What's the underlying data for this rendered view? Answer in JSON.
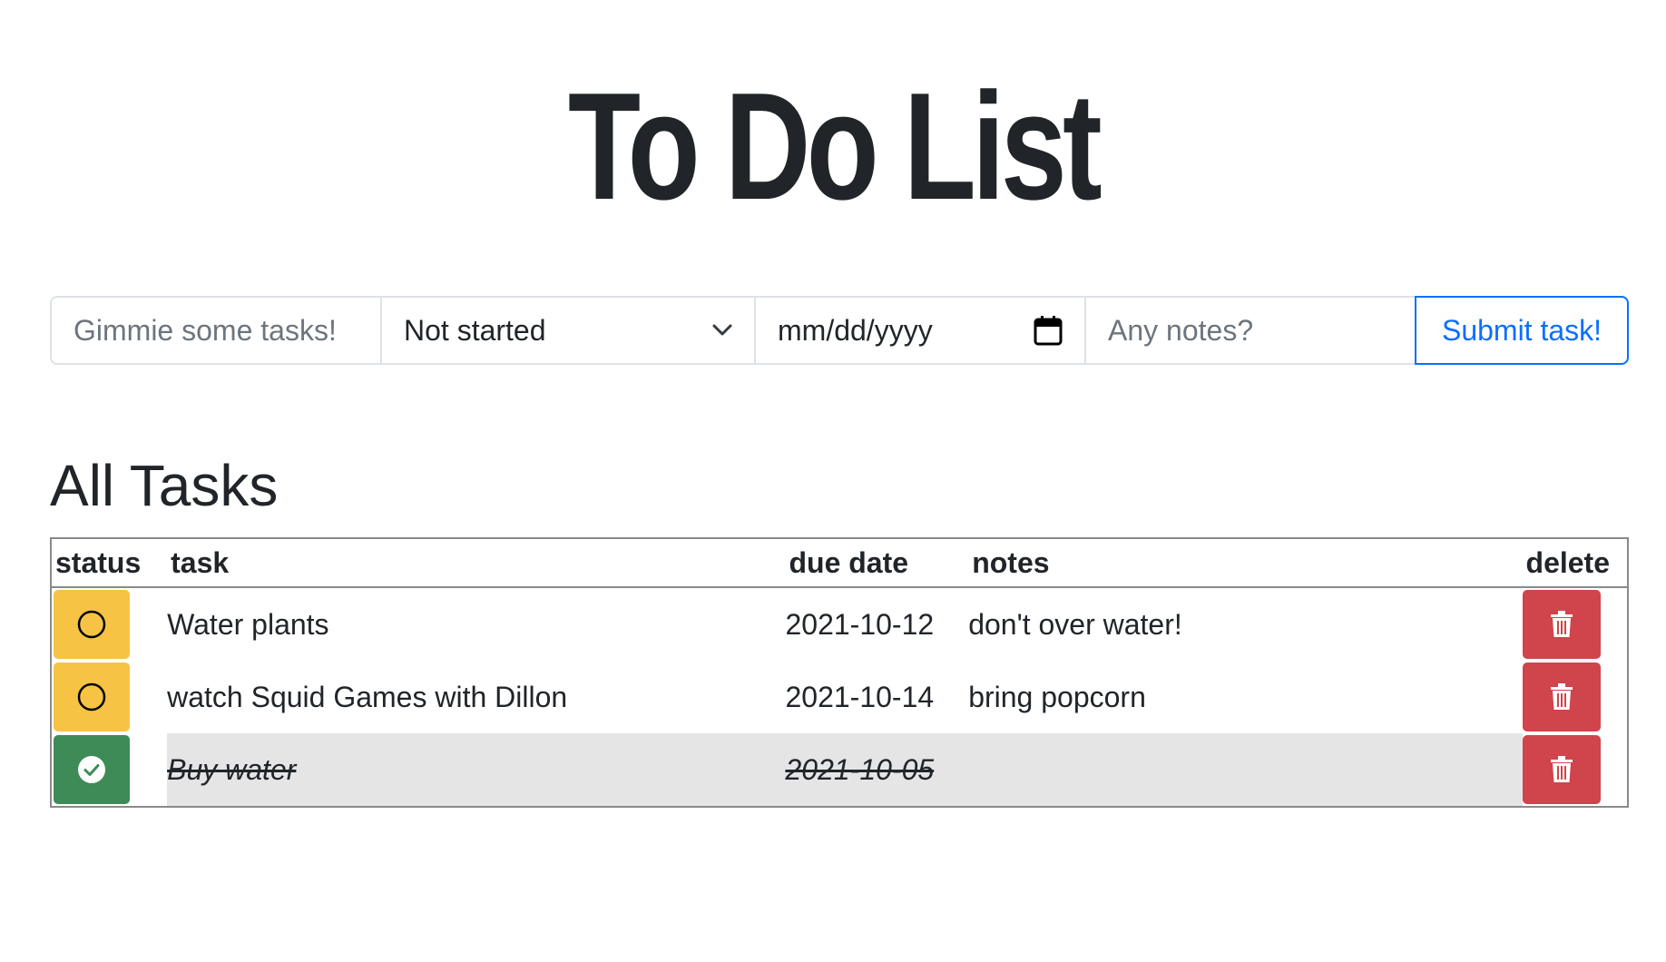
{
  "page": {
    "title": "To Do List"
  },
  "form": {
    "task_placeholder": "Gimmie some tasks!",
    "status_selected": "Not started",
    "date_placeholder": "mm/dd/yyyy",
    "notes_placeholder": "Any notes?",
    "submit_label": "Submit task!"
  },
  "section": {
    "title": "All Tasks"
  },
  "table": {
    "headers": {
      "status": "status",
      "task": "task",
      "due": "due date",
      "notes": "notes",
      "delete": "delete"
    },
    "rows": [
      {
        "task": "Water plants",
        "due": "2021-10-12",
        "notes": "don't over water!",
        "done": false
      },
      {
        "task": "watch Squid Games with Dillon",
        "due": "2021-10-14",
        "notes": "bring popcorn",
        "done": false
      },
      {
        "task": "Buy water",
        "due": "2021-10-05",
        "notes": "",
        "done": true
      }
    ]
  },
  "icons": {
    "status_todo": "circle-icon",
    "status_done": "check-circle-icon",
    "delete": "trash-icon",
    "select": "chevron-down-icon",
    "date": "calendar-icon"
  },
  "colors": {
    "text": "#212529",
    "primary": "#0d6efd",
    "status_todo": "#f6c344",
    "status_done": "#3e8b57",
    "delete": "#d0444b",
    "done_row": "#e6e5e6"
  }
}
